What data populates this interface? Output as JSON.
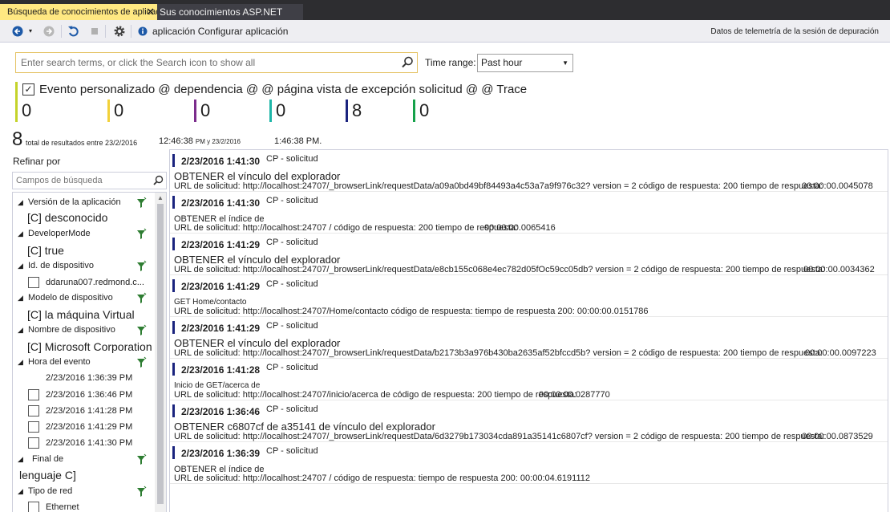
{
  "tabs": [
    {
      "label": "Búsqueda de conocimientos de aplicación",
      "close": "✕"
    },
    {
      "label": "Sus conocimientos ASP.NET"
    }
  ],
  "toolbar": {
    "config_link": "aplicación Configurar aplicación",
    "telemetry_label": "Datos de telemetría de la sesión de depuración"
  },
  "search": {
    "placeholder": "Enter search terms, or click the Search icon to show all",
    "time_range_label": "Time range:",
    "time_range_value": "Past hour"
  },
  "legend": {
    "title": "Evento personalizado @ dependencia @ @ página vista de excepción solicitud @ @ Trace",
    "counts": [
      {
        "value": "0",
        "color": "#c4d32a"
      },
      {
        "value": "0",
        "color": "#f2d13a"
      },
      {
        "value": "0",
        "color": "#7b2c8c"
      },
      {
        "value": "0",
        "color": "#1eb6a8"
      },
      {
        "value": "8",
        "color": "#1a237e"
      },
      {
        "value": "0",
        "color": "#15a14a"
      }
    ]
  },
  "summary": {
    "total": "8",
    "total_text": "total de resultados entre 23/2/2016",
    "start_time": "12:46:38",
    "start_suffix": "PM y 23/2/2016",
    "end_time": "1:46:38 PM."
  },
  "refine": {
    "title": "Refinar por",
    "field_search_placeholder": "Campos de búsqueda",
    "groups": {
      "app_version": {
        "label": "Versión de la aplicación",
        "value": "[C] desconocido"
      },
      "developer_mode": {
        "label": "DeveloperMode",
        "value": "[C] true"
      },
      "device_id": {
        "label": "Id. de dispositivo",
        "option": "ddaruna007.redmond.c..."
      },
      "device_model": {
        "label": "Modelo de dispositivo",
        "value": "[C] la máquina Virtual"
      },
      "device_name": {
        "label": "Nombre de dispositivo",
        "value": "[C] Microsoft Corporation"
      },
      "event_time": {
        "label": "Hora del evento",
        "options": [
          "2/23/2016 1:36:39 PM",
          "2/23/2016 1:36:46 PM",
          "2/23/2016 1:41:28 PM",
          "2/23/2016 1:41:29 PM",
          "2/23/2016 1:41:30 PM"
        ]
      },
      "end": {
        "label": "Final de",
        "value": "lenguaje C]"
      },
      "network_type": {
        "label": "Tipo de red",
        "option": "Ethernet"
      }
    }
  },
  "results": [
    {
      "date": "2/23/2016 1:41:30",
      "type": "CP - solicitud",
      "title": "OBTENER el vínculo del explorador",
      "detail": "URL de solicitud: http://localhost:24707/_browserLink/requestData/a09a0bd49bf84493a4c53a7a9f976c32? version = 2 código de respuesta: 200 tiempo de respuesta:",
      "duration": "00:00:00.0045078"
    },
    {
      "date": "2/23/2016 1:41:30",
      "type": "CP - solicitud",
      "title": "OBTENER el índice de",
      "detail": "URL de solicitud: http://localhost:24707 / código de respuesta: 200 tiempo de respuesta:",
      "duration": "00:00:00.0065416"
    },
    {
      "date": "2/23/2016 1:41:29",
      "type": "CP - solicitud",
      "title": "OBTENER el vínculo del explorador",
      "detail": "URL de solicitud: http://localhost:24707/_browserLink/requestData/e8cb155c068e4ec782d05fOc59cc05db? version = 2 código de respuesta: 200 tiempo de respuesta:",
      "duration": "00:00:00.0034362"
    },
    {
      "date": "2/23/2016 1:41:29",
      "type": "CP - solicitud",
      "title": "GET Home/contacto",
      "detail": "URL de solicitud: http://localhost:24707/Home/contacto código de respuesta: tiempo de respuesta 200: 00:00:00.0151786",
      "duration": ""
    },
    {
      "date": "2/23/2016 1:41:29",
      "type": "CP - solicitud",
      "title": "OBTENER el vínculo del explorador",
      "detail": "URL de solicitud: http://localhost:24707/_browserLink/requestData/b2173b3a976b430ba2635af52bfccd5b? version = 2 código de respuesta: 200 tiempo de respuesta:",
      "duration": "00:00:00.0097223"
    },
    {
      "date": "2/23/2016 1:41:28",
      "type": "CP - solicitud",
      "title": "Inicio de GET/acerca de",
      "detail": "URL de solicitud: http://localhost:24707/inicio/acerca de código de respuesta: 200 tiempo de respuesta:",
      "duration": "00:00:00.0287770"
    },
    {
      "date": "2/23/2016 1:36:46",
      "type": "CP - solicitud",
      "title": "OBTENER c6807cf de a35141 de vínculo del explorador",
      "detail": "URL de solicitud: http://localhost:24707/_browserLink/requestData/6d3279b173034cda891a35141c6807cf? version = 2 código de respuesta: 200 tiempo de respuesta:",
      "duration": "00:00:00.0873529"
    },
    {
      "date": "2/23/2016 1:36:39",
      "type": "CP - solicitud",
      "title": "OBTENER el índice de",
      "detail": "URL de solicitud: http://localhost:24707 / código de respuesta: tiempo de respuesta 200: 00:00:04.6191112",
      "duration": ""
    }
  ]
}
